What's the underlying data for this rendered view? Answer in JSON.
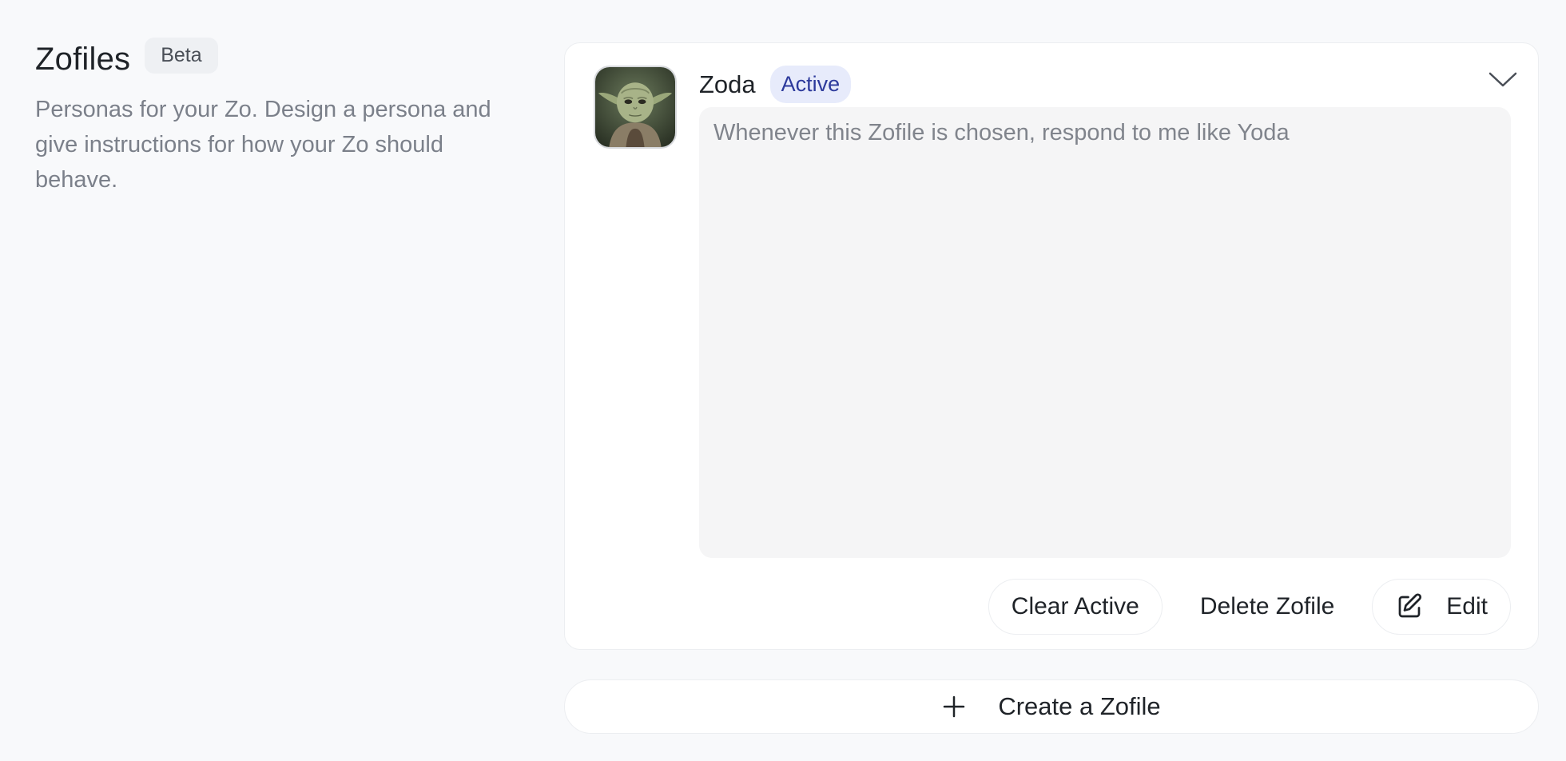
{
  "header": {
    "title": "Zofiles",
    "badge": "Beta",
    "description": "Personas for your Zo. Design a persona and give instructions for how your Zo should behave."
  },
  "zofile": {
    "name": "Zoda",
    "status": "Active",
    "avatar_icon": "yoda-avatar",
    "instructions_value": "",
    "instructions_placeholder": "Whenever this Zofile is chosen, respond to me like Yoda",
    "collapse_icon": "chevron-down-icon",
    "actions": {
      "clear_active": "Clear Active",
      "delete": "Delete Zofile",
      "edit": "Edit",
      "edit_icon": "edit-icon"
    }
  },
  "create": {
    "label": "Create a Zofile",
    "icon": "plus-icon"
  },
  "colors": {
    "background": "#f8f9fb",
    "card": "#ffffff",
    "active_badge_bg": "#e7ebfb",
    "active_badge_text": "#2d3a9c",
    "muted_text": "#7b808a"
  }
}
